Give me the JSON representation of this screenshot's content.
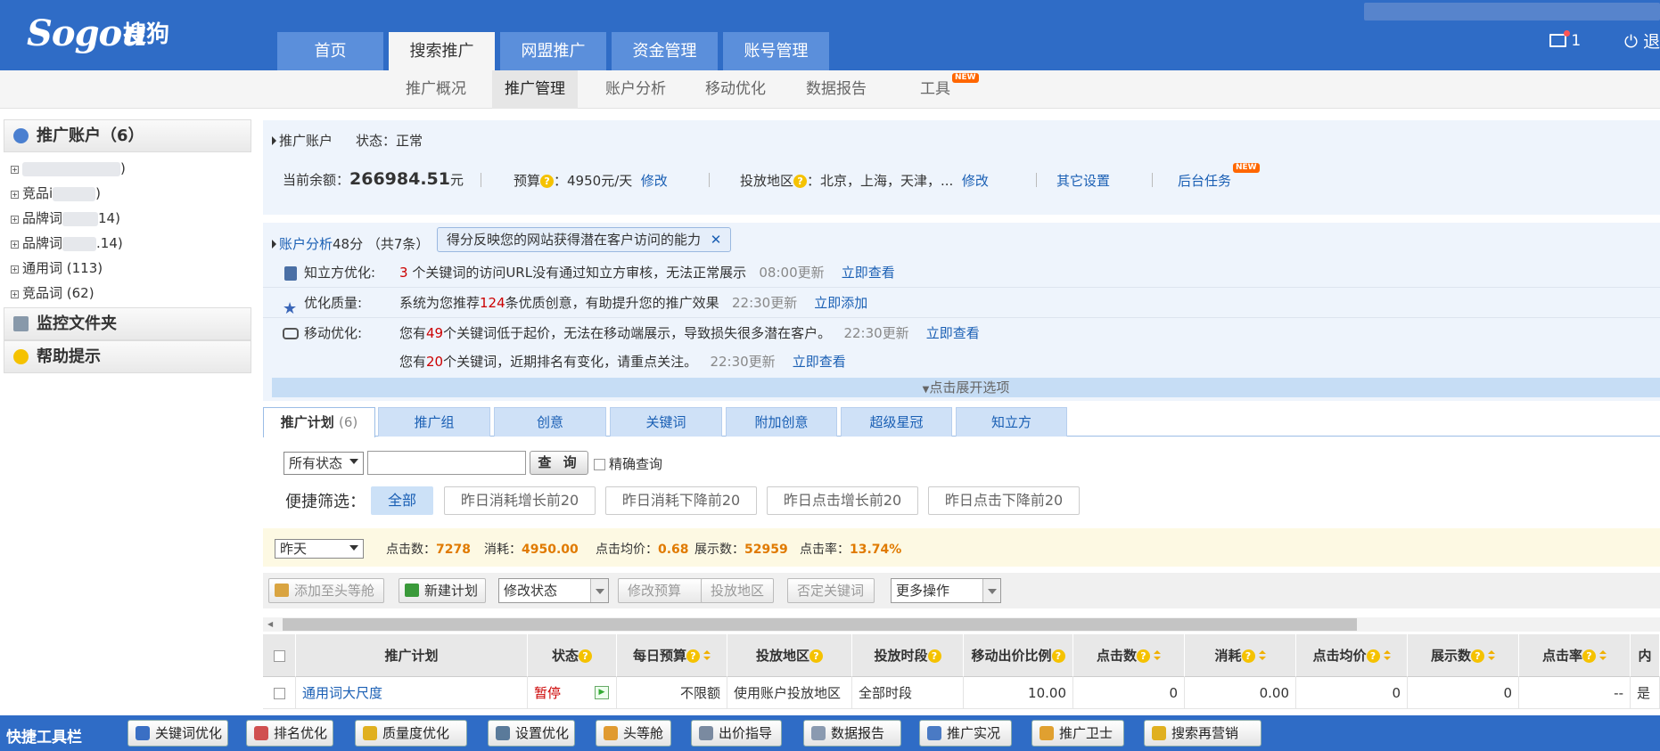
{
  "header": {
    "logo": "Sogou",
    "logo_cn": "搜狗",
    "nav_tabs": [
      "首页",
      "搜索推广",
      "网盟推广",
      "资金管理",
      "账号管理"
    ],
    "active_nav": "搜索推广",
    "mail_count": "1",
    "logout": "退"
  },
  "subnav": {
    "items": [
      "推广概况",
      "推广管理",
      "账户分析",
      "移动优化",
      "数据报告",
      "工具"
    ],
    "active": "推广管理",
    "new_badge": "NEW"
  },
  "sidebar": {
    "account_title": "推广账户（6）",
    "tree": [
      {
        "prefix": "",
        "suffix": ")"
      },
      {
        "prefix": "竞品i",
        "suffix": ")"
      },
      {
        "prefix": "品牌词",
        "suffix": "14)"
      },
      {
        "prefix": "品牌词",
        "suffix": ".14)"
      },
      {
        "prefix": "通用词 (113)",
        "suffix": ""
      },
      {
        "prefix": "竞品词 (62)",
        "suffix": ""
      }
    ],
    "monitor_title": "监控文件夹",
    "help_title": "帮助提示"
  },
  "account": {
    "label": "推广账户",
    "status": "状态：正常",
    "balance_label": "当前余额：",
    "balance_value": "266984.51",
    "balance_unit": "元",
    "budget_label": "预算",
    "budget_value": "：4950元/天",
    "budget_edit": "修改",
    "region_label": "投放地区",
    "region_value": "：北京，上海，天津，...",
    "region_edit": "修改",
    "other_settings": "其它设置",
    "bg_tasks": "后台任务",
    "new_badge": "NEW"
  },
  "analysis": {
    "title": "账户分析",
    "score": "48分",
    "count": "（共7条）",
    "tooltip": "得分反映您的网站获得潜在客户访问的能力",
    "rows": [
      {
        "label": "知立方优化:",
        "pre": "",
        "num": "3",
        "post": " 个关键词的访问URL没有通过知立方审核，无法正常展示",
        "time": "08:00更新",
        "link": "立即查看"
      },
      {
        "label": "优化质量:",
        "pre": "系统为您推荐",
        "num": "124",
        "post": "条优质创意，有助提升您的推广效果",
        "time": "22:30更新",
        "link": "立即添加"
      },
      {
        "label": "移动优化:",
        "pre": "您有",
        "num": "49",
        "post": "个关键词低于起价，无法在移动端展示，导致损失很多潜在客户。",
        "time": "22:30更新",
        "link": "立即查看"
      },
      {
        "label": "",
        "pre": "您有",
        "num": "20",
        "post": "个关键词，近期排名有变化，请重点关注。",
        "time": "22:30更新",
        "link": "立即查看"
      }
    ],
    "expand": "点击展开选项"
  },
  "tabs": [
    {
      "label": "推广计划",
      "count": "(6)"
    },
    {
      "label": "推广组",
      "count": ""
    },
    {
      "label": "创意",
      "count": ""
    },
    {
      "label": "关键词",
      "count": ""
    },
    {
      "label": "附加创意",
      "count": ""
    },
    {
      "label": "超级星冠",
      "count": ""
    },
    {
      "label": "知立方",
      "count": ""
    }
  ],
  "filter": {
    "status_select": "所有状态",
    "query_value": "",
    "query_button": "查 询",
    "exact_label": "精确查询",
    "quick_label": "便捷筛选：",
    "quick": [
      "全部",
      "昨日消耗增长前20",
      "昨日消耗下降前20",
      "昨日点击增长前20",
      "昨日点击下降前20"
    ]
  },
  "stats": {
    "period": "昨天",
    "clicks_label": "点击数：",
    "clicks": "7278",
    "cost_label": "消耗：",
    "cost": "4950.00",
    "cpc_label": "点击均价：",
    "cpc": "0.68",
    "impr_label": "展示数：",
    "impr": "52959",
    "ctr_label": "点击率：",
    "ctr": "13.74%"
  },
  "toolbar": {
    "add_top": "添加至头等舱",
    "new_plan": "新建计划",
    "modify_status": "修改状态",
    "modify_budget": "修改预算",
    "region": "投放地区",
    "negative_kw": "否定关键词",
    "more": "更多操作"
  },
  "table": {
    "headers": [
      "推广计划",
      "状态",
      "每日预算",
      "投放地区",
      "投放时段",
      "移动出价比例",
      "点击数",
      "消耗",
      "点击均价",
      "展示数",
      "点击率",
      "内"
    ],
    "rows": [
      {
        "plan": "通用词大尺度",
        "status": "暂停",
        "budget": "不限额",
        "region": "使用账户投放地区",
        "time": "全部时段",
        "mobile_ratio": "10.00",
        "clicks": "0",
        "cost": "0.00",
        "cpc": "0",
        "impr": "0",
        "ctr": "--",
        "extra": "是"
      }
    ]
  },
  "bottombar": {
    "label": "快捷工具栏",
    "items": [
      "关键词优化",
      "排名优化",
      "质量度优化",
      "设置优化",
      "头等舱",
      "出价指导",
      "数据报告",
      "推广实况",
      "推广卫士",
      "搜索再营销"
    ]
  },
  "colors": {
    "header_blue": "#2f6cc6",
    "accent_orange": "#e07a00",
    "link_blue": "#1a5fb4",
    "status_red": "#c00"
  }
}
